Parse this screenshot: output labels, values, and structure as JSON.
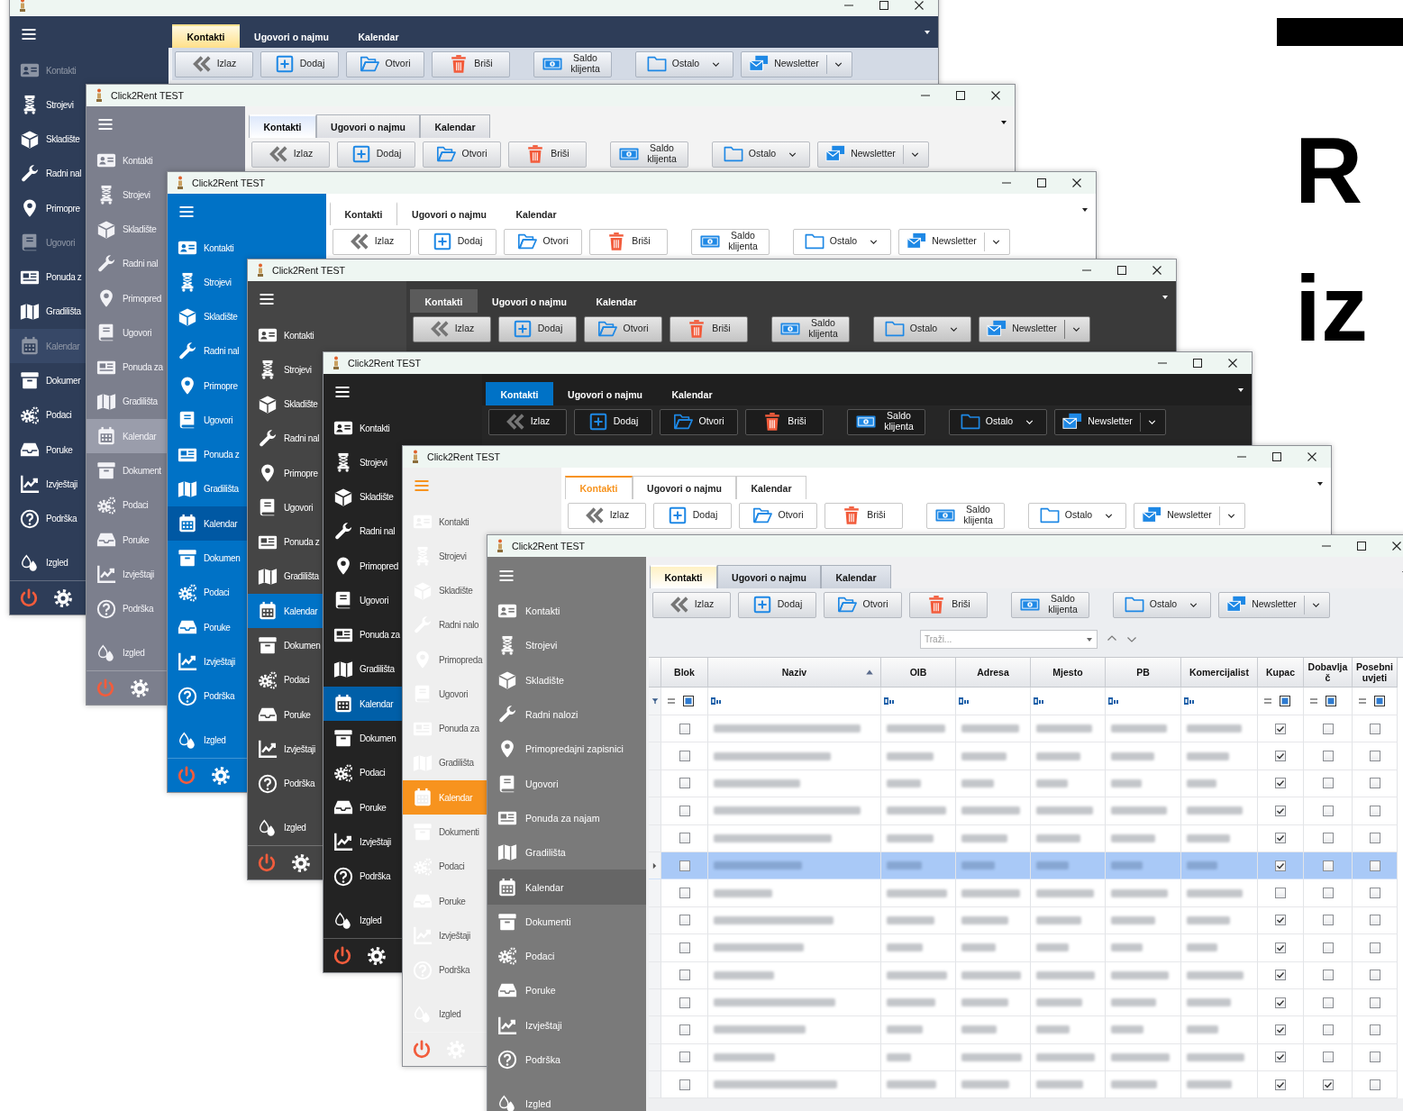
{
  "windows": [
    {
      "kind": "navy",
      "footer": true,
      "sidebar": [
        {
          "label": "Kontakti",
          "selected": false,
          "dimmed": true
        },
        {
          "label": "Strojevi",
          "selected": false,
          "dimmed": false
        },
        {
          "label": "Skladište",
          "selected": false,
          "dimmed": false
        },
        {
          "label": "Radni nal",
          "selected": false,
          "dimmed": false
        },
        {
          "label": "Primopre",
          "selected": false,
          "dimmed": false
        },
        {
          "label": "Ugovori",
          "selected": false,
          "dimmed": true
        },
        {
          "label": "Ponuda z",
          "selected": false,
          "dimmed": false
        },
        {
          "label": "Gradilišta",
          "selected": false,
          "dimmed": false
        },
        {
          "label": "Kalendar",
          "selected": true,
          "dimmed": true
        },
        {
          "label": "Dokumer",
          "selected": false,
          "dimmed": false
        },
        {
          "label": "Podaci",
          "selected": false,
          "dimmed": false
        },
        {
          "label": "Poruke",
          "selected": false,
          "dimmed": false
        },
        {
          "label": "Izvještaji",
          "selected": false,
          "dimmed": false
        },
        {
          "label": "Podrška",
          "selected": false,
          "dimmed": false
        },
        {
          "label": "Izgled",
          "selected": false,
          "dimmed": false
        }
      ],
      "tabs": [
        {
          "label": "Kontakti",
          "selected": true
        },
        {
          "label": "Ugovori o najmu",
          "selected": false
        },
        {
          "label": "Kalendar",
          "selected": false
        }
      ],
      "toolbar": [
        {
          "label": "Izlaz",
          "dropdown": false
        },
        {
          "label": "Dodaj",
          "dropdown": false
        },
        {
          "label": "Otvori",
          "dropdown": false
        },
        {
          "label": "Briši",
          "dropdown": false
        },
        {
          "label": "Saldo klijenta",
          "dropdown": false
        },
        {
          "label": "Ostalo",
          "dropdown": true
        },
        {
          "label": "Newsletter",
          "dropdown": true
        }
      ]
    },
    {
      "kind": "slate",
      "title": "Click2Rent TEST",
      "footer": true,
      "sidebar": [
        {
          "label": "Kontakti",
          "selected": false
        },
        {
          "label": "Strojevi",
          "selected": false
        },
        {
          "label": "Skladište",
          "selected": false
        },
        {
          "label": "Radni nal",
          "selected": false
        },
        {
          "label": "Primopred",
          "selected": false
        },
        {
          "label": "Ugovori",
          "selected": false
        },
        {
          "label": "Ponuda za",
          "selected": false
        },
        {
          "label": "Gradilišta",
          "selected": false
        },
        {
          "label": "Kalendar",
          "selected": true
        },
        {
          "label": "Dokument",
          "selected": false
        },
        {
          "label": "Podaci",
          "selected": false
        },
        {
          "label": "Poruke",
          "selected": false
        },
        {
          "label": "Izvještaji",
          "selected": false
        },
        {
          "label": "Podrška",
          "selected": false
        },
        {
          "label": "Izgled",
          "selected": false
        }
      ],
      "tabs": [
        {
          "label": "Kontakti",
          "selected": true
        },
        {
          "label": "Ugovori o najmu",
          "selected": false
        },
        {
          "label": "Kalendar",
          "selected": false
        }
      ],
      "toolbar": [
        {
          "label": "Izlaz",
          "dropdown": false
        },
        {
          "label": "Dodaj",
          "dropdown": false
        },
        {
          "label": "Otvori",
          "dropdown": false
        },
        {
          "label": "Briši",
          "dropdown": false
        },
        {
          "label": "Saldo klijenta",
          "dropdown": false
        },
        {
          "label": "Ostalo",
          "dropdown": true
        },
        {
          "label": "Newsletter",
          "dropdown": true
        }
      ]
    },
    {
      "kind": "blue",
      "title": "Click2Rent TEST",
      "footer": true,
      "sidebar": [
        {
          "label": "Kontakti",
          "selected": false
        },
        {
          "label": "Strojevi",
          "selected": false
        },
        {
          "label": "Skladište",
          "selected": false
        },
        {
          "label": "Radni nal",
          "selected": false
        },
        {
          "label": "Primopre",
          "selected": false
        },
        {
          "label": "Ugovori",
          "selected": false
        },
        {
          "label": "Ponuda z",
          "selected": false
        },
        {
          "label": "Gradilišta",
          "selected": false
        },
        {
          "label": "Kalendar",
          "selected": true
        },
        {
          "label": "Dokumen",
          "selected": false
        },
        {
          "label": "Podaci",
          "selected": false
        },
        {
          "label": "Poruke",
          "selected": false
        },
        {
          "label": "Izvještaji",
          "selected": false
        },
        {
          "label": "Podrška",
          "selected": false
        },
        {
          "label": "Izgled",
          "selected": false
        }
      ],
      "tabs": [
        {
          "label": "Kontakti",
          "selected": true
        },
        {
          "label": "Ugovori o najmu",
          "selected": false
        },
        {
          "label": "Kalendar",
          "selected": false
        }
      ],
      "toolbar": [
        {
          "label": "Izlaz",
          "dropdown": false
        },
        {
          "label": "Dodaj",
          "dropdown": false
        },
        {
          "label": "Otvori",
          "dropdown": false
        },
        {
          "label": "Briši",
          "dropdown": false
        },
        {
          "label": "Saldo klijenta",
          "dropdown": false
        },
        {
          "label": "Ostalo",
          "dropdown": true
        },
        {
          "label": "Newsletter",
          "dropdown": true
        }
      ]
    },
    {
      "kind": "charcoal",
      "title": "Click2Rent TEST",
      "footer": true,
      "sidebar": [
        {
          "label": "Kontakti",
          "selected": false
        },
        {
          "label": "Strojevi",
          "selected": false
        },
        {
          "label": "Skladište",
          "selected": false
        },
        {
          "label": "Radni nal",
          "selected": false
        },
        {
          "label": "Primopre",
          "selected": false
        },
        {
          "label": "Ugovori",
          "selected": false
        },
        {
          "label": "Ponuda z",
          "selected": false
        },
        {
          "label": "Gradilišta",
          "selected": false
        },
        {
          "label": "Kalendar",
          "selected": true
        },
        {
          "label": "Dokumen",
          "selected": false
        },
        {
          "label": "Podaci",
          "selected": false
        },
        {
          "label": "Poruke",
          "selected": false
        },
        {
          "label": "Izvještaji",
          "selected": false
        },
        {
          "label": "Podrška",
          "selected": false
        },
        {
          "label": "Izgled",
          "selected": false
        }
      ],
      "tabs": [
        {
          "label": "Kontakti",
          "selected": true
        },
        {
          "label": "Ugovori o najmu",
          "selected": false
        },
        {
          "label": "Kalendar",
          "selected": false
        }
      ],
      "toolbar": [
        {
          "label": "Izlaz",
          "dropdown": false
        },
        {
          "label": "Dodaj",
          "dropdown": false
        },
        {
          "label": "Otvori",
          "dropdown": false
        },
        {
          "label": "Briši",
          "dropdown": false
        },
        {
          "label": "Saldo klijenta",
          "dropdown": false
        },
        {
          "label": "Ostalo",
          "dropdown": true
        },
        {
          "label": "Newsletter",
          "dropdown": true
        }
      ]
    },
    {
      "kind": "dark",
      "title": "Click2Rent TEST",
      "footer": true,
      "sidebar": [
        {
          "label": "Kontakti",
          "selected": false
        },
        {
          "label": "Strojevi",
          "selected": false
        },
        {
          "label": "Skladište",
          "selected": false
        },
        {
          "label": "Radni nal",
          "selected": false
        },
        {
          "label": "Primopred",
          "selected": false
        },
        {
          "label": "Ugovori",
          "selected": false
        },
        {
          "label": "Ponuda za",
          "selected": false
        },
        {
          "label": "Gradilišta",
          "selected": false
        },
        {
          "label": "Kalendar",
          "selected": true
        },
        {
          "label": "Dokumen",
          "selected": false
        },
        {
          "label": "Podaci",
          "selected": false
        },
        {
          "label": "Poruke",
          "selected": false
        },
        {
          "label": "Izvještaji",
          "selected": false
        },
        {
          "label": "Podrška",
          "selected": false
        },
        {
          "label": "Izgled",
          "selected": false
        }
      ],
      "tabs": [
        {
          "label": "Kontakti",
          "selected": true
        },
        {
          "label": "Ugovori o najmu",
          "selected": false
        },
        {
          "label": "Kalendar",
          "selected": false
        }
      ],
      "toolbar": [
        {
          "label": "Izlaz",
          "dropdown": false
        },
        {
          "label": "Dodaj",
          "dropdown": false
        },
        {
          "label": "Otvori",
          "dropdown": false
        },
        {
          "label": "Briši",
          "dropdown": false
        },
        {
          "label": "Saldo klijenta",
          "dropdown": false
        },
        {
          "label": "Ostalo",
          "dropdown": true
        },
        {
          "label": "Newsletter",
          "dropdown": true
        }
      ]
    },
    {
      "kind": "light",
      "title": "Click2Rent TEST",
      "footer": true,
      "sidebar": [
        {
          "label": "Kontakti",
          "selected": false
        },
        {
          "label": "Strojevi",
          "selected": false
        },
        {
          "label": "Skladište",
          "selected": false
        },
        {
          "label": "Radni nalo",
          "selected": false
        },
        {
          "label": "Primopreda",
          "selected": false
        },
        {
          "label": "Ugovori",
          "selected": false
        },
        {
          "label": "Ponuda za",
          "selected": false
        },
        {
          "label": "Gradilišta",
          "selected": false
        },
        {
          "label": "Kalendar",
          "selected": true
        },
        {
          "label": "Dokumenti",
          "selected": false
        },
        {
          "label": "Podaci",
          "selected": false
        },
        {
          "label": "Poruke",
          "selected": false
        },
        {
          "label": "Izvještaji",
          "selected": false
        },
        {
          "label": "Podrška",
          "selected": false
        },
        {
          "label": "Izgled",
          "selected": false
        }
      ],
      "tabs": [
        {
          "label": "Kontakti",
          "selected": true
        },
        {
          "label": "Ugovori o najmu",
          "selected": false
        },
        {
          "label": "Kalendar",
          "selected": false
        }
      ],
      "toolbar": [
        {
          "label": "Izlaz",
          "dropdown": false
        },
        {
          "label": "Dodaj",
          "dropdown": false
        },
        {
          "label": "Otvori",
          "dropdown": false
        },
        {
          "label": "Briši",
          "dropdown": false
        },
        {
          "label": "Saldo klijenta",
          "dropdown": false
        },
        {
          "label": "Ostalo",
          "dropdown": true
        },
        {
          "label": "Newsletter",
          "dropdown": true
        }
      ]
    },
    {
      "kind": "gray",
      "title": "Click2Rent TEST",
      "sidebar": [
        {
          "label": "Kontakti",
          "selected": false
        },
        {
          "label": "Strojevi",
          "selected": false
        },
        {
          "label": "Skladište",
          "selected": false
        },
        {
          "label": "Radni nalozi",
          "selected": false
        },
        {
          "label": "Primopredajni zapisnici",
          "selected": false
        },
        {
          "label": "Ugovori",
          "selected": false
        },
        {
          "label": "Ponuda za najam",
          "selected": false
        },
        {
          "label": "Gradilišta",
          "selected": false
        },
        {
          "label": "Kalendar",
          "selected": true
        },
        {
          "label": "Dokumenti",
          "selected": false
        },
        {
          "label": "Podaci",
          "selected": false
        },
        {
          "label": "Poruke",
          "selected": false
        },
        {
          "label": "Izvještaji",
          "selected": false
        },
        {
          "label": "Podrška",
          "selected": false
        },
        {
          "label": "Izgled",
          "selected": false
        }
      ],
      "tabs": [
        {
          "label": "Kontakti",
          "selected": true
        },
        {
          "label": "Ugovori o najmu",
          "selected": false
        },
        {
          "label": "Kalendar",
          "selected": false
        }
      ],
      "toolbar": [
        {
          "label": "Izlaz",
          "dropdown": false
        },
        {
          "label": "Dodaj",
          "dropdown": false
        },
        {
          "label": "Otvori",
          "dropdown": false
        },
        {
          "label": "Briši",
          "dropdown": false
        },
        {
          "label": "Saldo klijenta",
          "dropdown": false
        },
        {
          "label": "Ostalo",
          "dropdown": true
        },
        {
          "label": "Newsletter",
          "dropdown": true
        }
      ],
      "search": {
        "placeholder": "Traži..."
      },
      "grid": {
        "columns": [
          {
            "label": "Blok",
            "kind": "check",
            "sorted": false
          },
          {
            "label": "Naziv",
            "kind": "text",
            "sorted": true
          },
          {
            "label": "OIB",
            "kind": "text",
            "sorted": false
          },
          {
            "label": "Adresa",
            "kind": "text",
            "sorted": false
          },
          {
            "label": "Mjesto",
            "kind": "text",
            "sorted": false
          },
          {
            "label": "PB",
            "kind": "text",
            "sorted": false
          },
          {
            "label": "Komercijalist",
            "kind": "text",
            "sorted": false
          },
          {
            "label": "Kupac",
            "kind": "check",
            "sorted": false
          },
          {
            "label": "Dobavljač",
            "kind": "check",
            "sorted": false
          },
          {
            "label": "Posebni uvjeti",
            "kind": "check",
            "sorted": false
          }
        ],
        "rows": [
          {
            "selected": false,
            "checks": [
              false,
              true,
              false,
              false
            ]
          },
          {
            "selected": false,
            "checks": [
              false,
              true,
              false,
              false
            ]
          },
          {
            "selected": false,
            "checks": [
              false,
              true,
              false,
              false
            ]
          },
          {
            "selected": false,
            "checks": [
              false,
              true,
              false,
              false
            ]
          },
          {
            "selected": false,
            "checks": [
              false,
              true,
              false,
              false
            ]
          },
          {
            "selected": true,
            "checks": [
              false,
              true,
              false,
              false
            ]
          },
          {
            "selected": false,
            "checks": [
              false,
              false,
              false,
              false
            ]
          },
          {
            "selected": false,
            "checks": [
              false,
              true,
              false,
              false
            ]
          },
          {
            "selected": false,
            "checks": [
              false,
              true,
              false,
              false
            ]
          },
          {
            "selected": false,
            "checks": [
              false,
              true,
              false,
              false
            ]
          },
          {
            "selected": false,
            "checks": [
              false,
              true,
              false,
              false
            ]
          },
          {
            "selected": false,
            "checks": [
              false,
              true,
              false,
              false
            ]
          },
          {
            "selected": false,
            "checks": [
              false,
              true,
              false,
              false
            ]
          },
          {
            "selected": false,
            "checks": [
              false,
              true,
              true,
              false
            ]
          }
        ]
      }
    }
  ],
  "slide": {
    "headline_1": "R",
    "headline_2": "iz"
  }
}
